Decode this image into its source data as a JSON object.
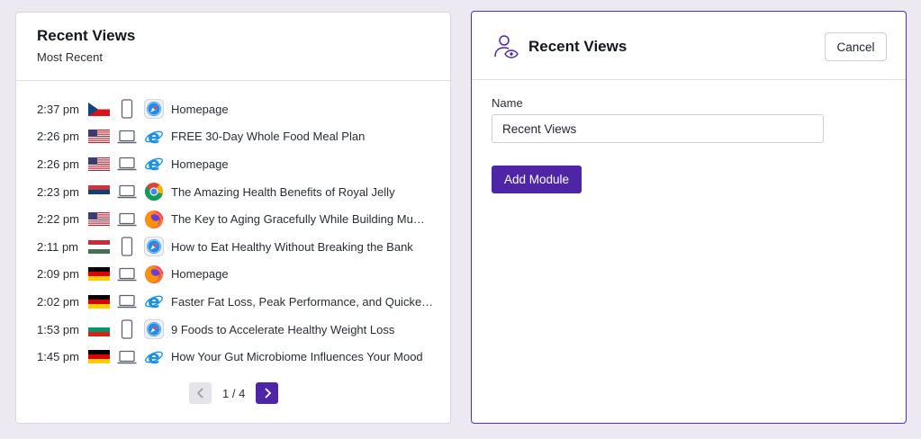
{
  "left_panel": {
    "title": "Recent Views",
    "subtitle": "Most Recent",
    "rows": [
      {
        "time": "2:37 pm",
        "flag": "czech-republic",
        "device": "mobile",
        "browser": "safari",
        "page": "Homepage"
      },
      {
        "time": "2:26 pm",
        "flag": "united-states",
        "device": "laptop",
        "browser": "internet-explorer",
        "page": "FREE 30-Day Whole Food Meal Plan"
      },
      {
        "time": "2:26 pm",
        "flag": "united-states",
        "device": "laptop",
        "browser": "internet-explorer",
        "page": "Homepage"
      },
      {
        "time": "2:23 pm",
        "flag": "serbia",
        "device": "laptop",
        "browser": "chrome",
        "page": "The Amazing Health Benefits of Royal Jelly"
      },
      {
        "time": "2:22 pm",
        "flag": "united-states",
        "device": "laptop",
        "browser": "firefox",
        "page": "The Key to Aging Gracefully While Building Mu…"
      },
      {
        "time": "2:11 pm",
        "flag": "hungary",
        "device": "mobile",
        "browser": "safari",
        "page": "How to Eat Healthy Without Breaking the Bank"
      },
      {
        "time": "2:09 pm",
        "flag": "germany",
        "device": "laptop",
        "browser": "firefox",
        "page": "Homepage"
      },
      {
        "time": "2:02 pm",
        "flag": "germany",
        "device": "laptop",
        "browser": "internet-explorer",
        "page": "Faster Fat Loss, Peak Performance, and Quicke…"
      },
      {
        "time": "1:53 pm",
        "flag": "bulgaria",
        "device": "mobile",
        "browser": "safari",
        "page": "9 Foods to Accelerate Healthy Weight Loss"
      },
      {
        "time": "1:45 pm",
        "flag": "germany",
        "device": "laptop",
        "browser": "internet-explorer",
        "page": "How Your Gut Microbiome Influences Your Mood"
      }
    ],
    "pagination": {
      "label": "1 / 4"
    }
  },
  "right_panel": {
    "title": "Recent Views",
    "icon": "user-eye-icon",
    "cancel_label": "Cancel",
    "name_label": "Name",
    "name_value": "Recent Views",
    "add_button_label": "Add Module"
  },
  "colors": {
    "accent": "#4f25a8",
    "page_background": "#ece9f3",
    "card_border_active": "#5a2fa6"
  },
  "flags": {
    "czech-republic": {
      "type": "czech",
      "colors": [
        "#ffffff",
        "#d7141a",
        "#11457e"
      ]
    },
    "united-states": {
      "type": "us",
      "colors": [
        "#b22234",
        "#ffffff",
        "#3c3b6e"
      ]
    },
    "serbia": {
      "type": "stripes",
      "colors": [
        "#c6363c",
        "#0c4076",
        "#ffffff"
      ]
    },
    "hungary": {
      "type": "stripes",
      "colors": [
        "#ce2939",
        "#ffffff",
        "#477050"
      ]
    },
    "germany": {
      "type": "stripes",
      "colors": [
        "#000000",
        "#dd0000",
        "#ffce00"
      ]
    },
    "bulgaria": {
      "type": "stripes",
      "colors": [
        "#ffffff",
        "#00966e",
        "#d62612"
      ]
    }
  }
}
